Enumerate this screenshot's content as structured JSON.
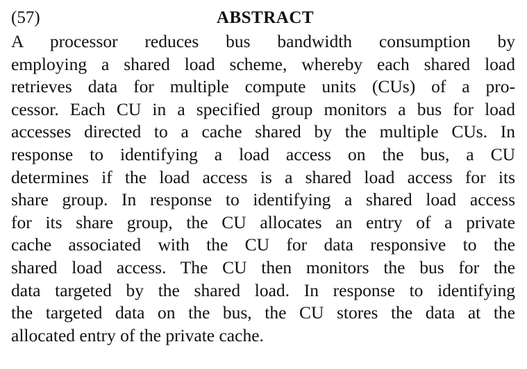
{
  "document": {
    "section_number": "(57)",
    "section_title": "ABSTRACT",
    "lines": [
      "A processor reduces bus bandwidth consumption by",
      "employing a shared load scheme, whereby each shared load",
      "retrieves data for multiple compute units (CUs) of a pro-",
      "cessor. Each CU in a specified group monitors a bus for load",
      "accesses directed to a cache shared by the multiple CUs. In",
      "response to identifying a load access on the bus, a CU",
      "determines if the load access is a shared load access for its",
      "share group. In response to identifying a shared load access",
      "for its share group, the CU allocates an entry of a private",
      "cache associated with the CU for data responsive to the",
      "shared load access. The CU then monitors the bus for the",
      "data targeted by the shared load. In response to identifying",
      "the targeted data on the bus, the CU stores the data at the",
      "allocated entry of the private cache."
    ]
  }
}
